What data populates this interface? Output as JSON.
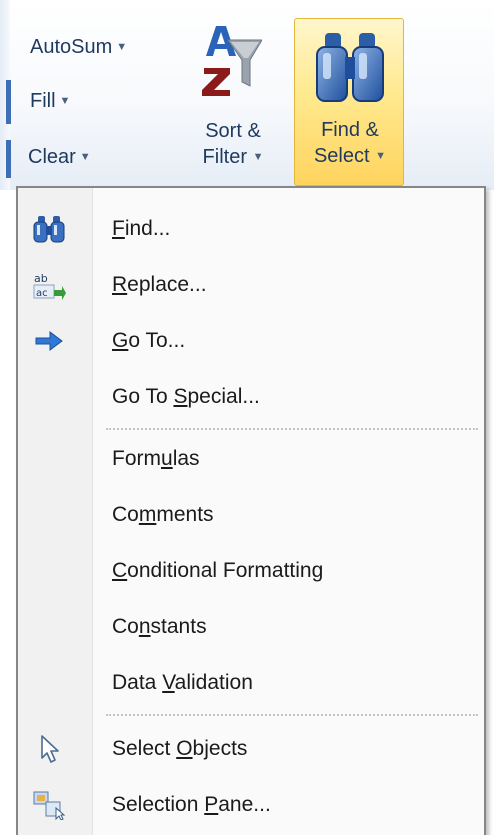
{
  "ribbon": {
    "autosum": "AutoSum",
    "fill": "Fill",
    "clear": "Clear",
    "sort_filter": {
      "line1": "Sort &",
      "line2": "Filter"
    },
    "find_select": {
      "line1": "Find &",
      "line2": "Select"
    },
    "dropdown_arrow": "▼"
  },
  "menu": {
    "items": [
      {
        "pre": "",
        "ul": "F",
        "post": "ind...",
        "icon": "binoculars-icon"
      },
      {
        "pre": "",
        "ul": "R",
        "post": "eplace...",
        "icon": "replace-icon"
      },
      {
        "pre": "",
        "ul": "G",
        "post": "o To...",
        "icon": "go-to-arrow-icon"
      },
      {
        "pre": "Go To ",
        "ul": "S",
        "post": "pecial...",
        "icon": ""
      },
      {
        "pre": "Form",
        "ul": "u",
        "post": "las",
        "icon": ""
      },
      {
        "pre": "Co",
        "ul": "m",
        "post": "ments",
        "icon": ""
      },
      {
        "pre": "",
        "ul": "C",
        "post": "onditional Formatting",
        "icon": ""
      },
      {
        "pre": "Co",
        "ul": "n",
        "post": "stants",
        "icon": ""
      },
      {
        "pre": "Data ",
        "ul": "V",
        "post": "alidation",
        "icon": ""
      },
      {
        "pre": "Select ",
        "ul": "O",
        "post": "bjects",
        "icon": "select-objects-cursor-icon"
      },
      {
        "pre": "Selection ",
        "ul": "P",
        "post": "ane...",
        "icon": "selection-pane-icon"
      }
    ]
  }
}
